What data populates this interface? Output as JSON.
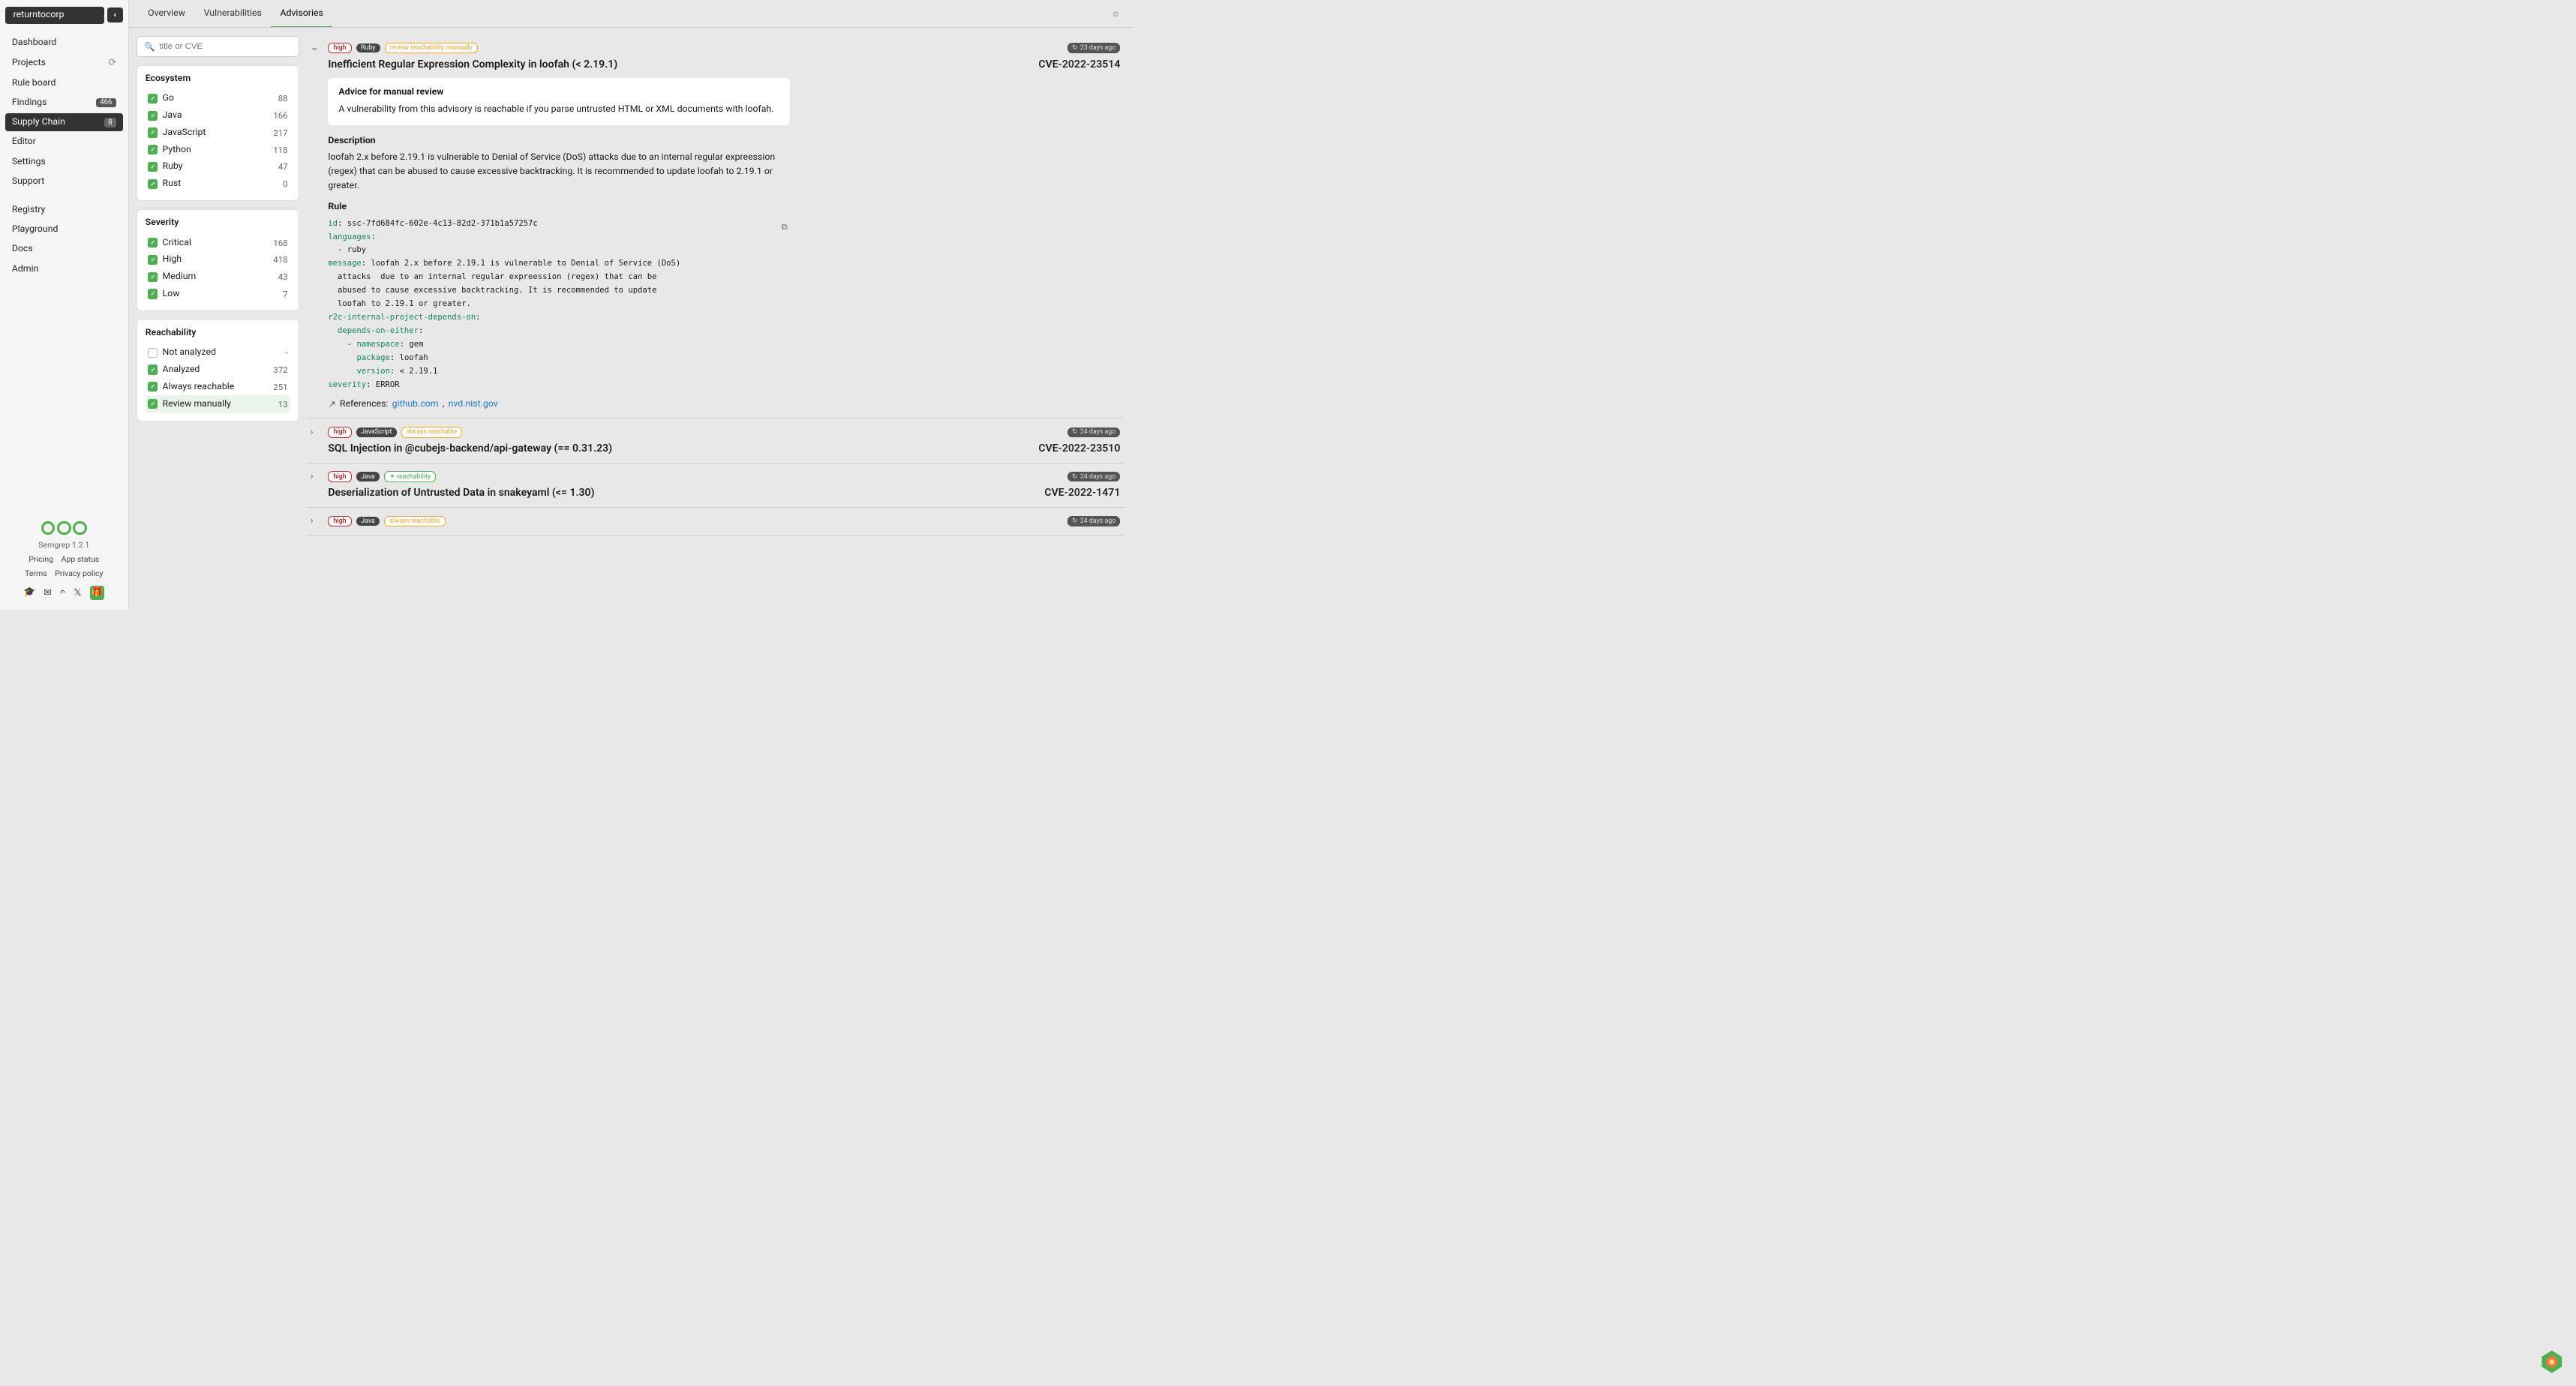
{
  "org": "returntocorp",
  "nav": [
    {
      "label": "Dashboard"
    },
    {
      "label": "Projects",
      "icon": true
    },
    {
      "label": "Rule board"
    },
    {
      "label": "Findings",
      "badge": "466"
    },
    {
      "label": "Supply Chain",
      "badge": "8",
      "active": true
    },
    {
      "label": "Editor"
    },
    {
      "label": "Settings"
    },
    {
      "label": "Support"
    }
  ],
  "nav2": [
    {
      "label": "Registry"
    },
    {
      "label": "Playground"
    },
    {
      "label": "Docs"
    },
    {
      "label": "Admin"
    }
  ],
  "version": "Semgrep 1.2.1",
  "footer_links": {
    "pricing": "Pricing",
    "app_status": "App status",
    "terms": "Terms",
    "privacy": "Privacy policy"
  },
  "tabs": {
    "overview": "Overview",
    "vulnerabilities": "Vulnerabilities",
    "advisories": "Advisories"
  },
  "search_placeholder": "title or CVE",
  "filters": {
    "ecosystem": {
      "title": "Ecosystem",
      "items": [
        {
          "label": "Go",
          "count": "88",
          "checked": true
        },
        {
          "label": "Java",
          "count": "166",
          "checked": true
        },
        {
          "label": "JavaScript",
          "count": "217",
          "checked": true
        },
        {
          "label": "Python",
          "count": "118",
          "checked": true
        },
        {
          "label": "Ruby",
          "count": "47",
          "checked": true
        },
        {
          "label": "Rust",
          "count": "0",
          "checked": true
        }
      ]
    },
    "severity": {
      "title": "Severity",
      "items": [
        {
          "label": "Critical",
          "count": "168",
          "checked": true
        },
        {
          "label": "High",
          "count": "418",
          "checked": true
        },
        {
          "label": "Medium",
          "count": "43",
          "checked": true
        },
        {
          "label": "Low",
          "count": "7",
          "checked": true
        }
      ]
    },
    "reachability": {
      "title": "Reachability",
      "items": [
        {
          "label": "Not analyzed",
          "count": "-",
          "checked": false
        },
        {
          "label": "Analyzed",
          "count": "372",
          "checked": true
        },
        {
          "label": "Always reachable",
          "count": "251",
          "checked": true
        },
        {
          "label": "Review manually",
          "count": "13",
          "checked": true,
          "highlighted": true
        }
      ]
    }
  },
  "advisories": [
    {
      "severity": "high",
      "lang": "Ruby",
      "reach": "review reachability manually",
      "reach_class": "review",
      "time": "23 days ago",
      "title": "Inefficient Regular Expression Complexity in loofah (< 2.19.1)",
      "cve": "CVE-2022-23514",
      "expanded": true,
      "advice_title": "Advice for manual review",
      "advice": "A vulnerability from this advisory is reachable if you parse untrusted HTML or XML documents with loofah.",
      "desc_title": "Description",
      "desc": "loofah 2.x before 2.19.1 is vulnerable to Denial of Service (DoS) attacks due to an internal regular expreession (regex) that can be abused to cause excessive backtracking. It is recommended to update loofah to 2.19.1 or greater.",
      "rule_title": "Rule",
      "rule": {
        "id": "ssc-7fd684fc-602e-4c13-82d2-371b1a57257c",
        "message": "loofah 2.x before 2.19.1 is vulnerable to Denial of Service (DoS) attacks  due to an internal regular expreession (regex) that can be abused to cause excessive backtracking. It is recommended to update loofah to 2.19.1 or greater.",
        "namespace": "gem",
        "package": "loofah",
        "version": "< 2.19.1",
        "severity": "ERROR"
      },
      "refs_label": "References:",
      "refs": [
        {
          "label": "github.com"
        },
        {
          "label": "nvd.nist.gov"
        }
      ]
    },
    {
      "severity": "high",
      "lang": "JavaScript",
      "reach": "always reachable",
      "reach_class": "always",
      "time": "24 days ago",
      "title": "SQL Injection in @cubejs-backend/api-gateway (== 0.31.23)",
      "cve": "CVE-2022-23510"
    },
    {
      "severity": "high",
      "lang": "Java",
      "reach": "reachability",
      "reach_class": "reachability",
      "time": "24 days ago",
      "title": "Deserialization of Untrusted Data in snakeyaml (<= 1.30)",
      "cve": "CVE-2022-1471"
    },
    {
      "severity": "high",
      "lang": "Java",
      "reach": "always reachable",
      "reach_class": "always",
      "time": "24 days ago",
      "title": "",
      "cve": ""
    }
  ]
}
